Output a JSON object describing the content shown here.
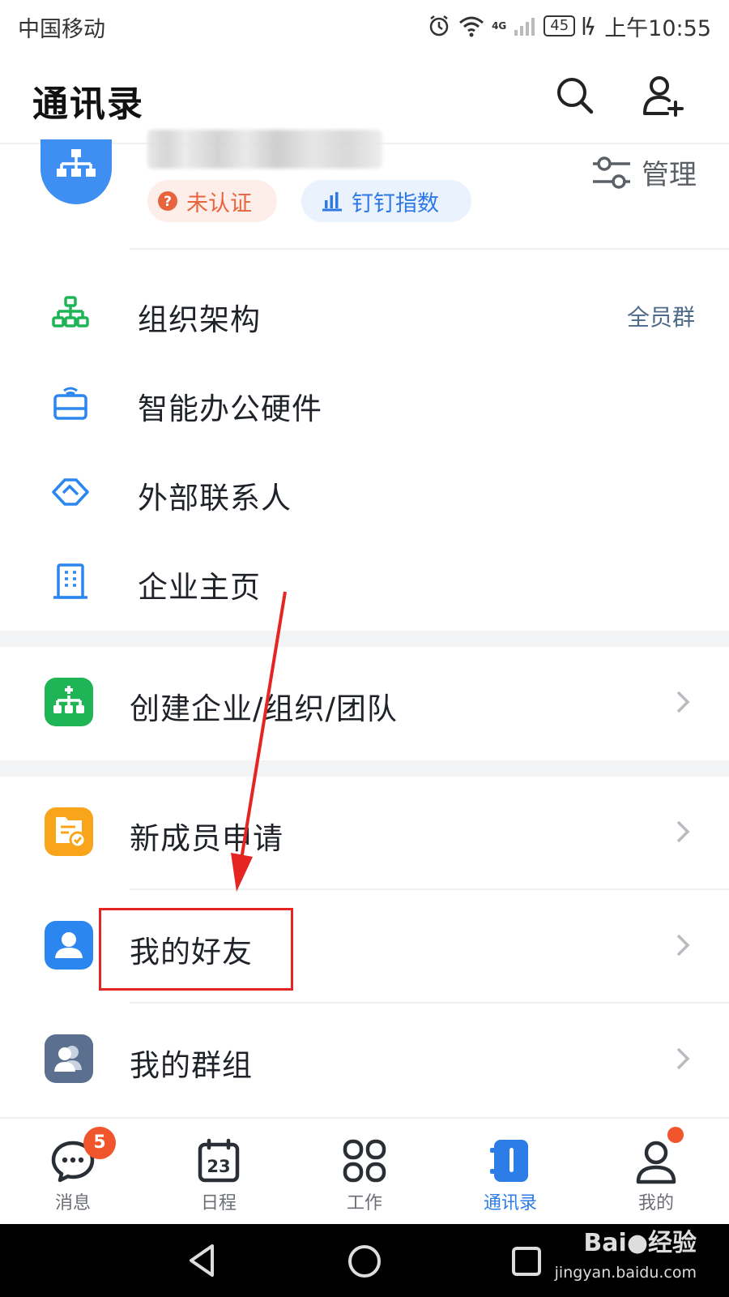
{
  "status_bar": {
    "carrier": "中国移动",
    "network": "4G",
    "battery": "45",
    "time": "上午10:55"
  },
  "header": {
    "title": "通讯录",
    "search_icon": "search-icon",
    "add_contact_icon": "add-contact-icon"
  },
  "org_card": {
    "avatar_icon": "org-hierarchy-icon",
    "badge_unverified": "未认证",
    "badge_index": "钉钉指数",
    "manage_label": "管理"
  },
  "menu": [
    {
      "label": "组织架构",
      "extra": "全员群",
      "icon": "org-tree-icon"
    },
    {
      "label": "智能办公硬件",
      "icon": "hardware-icon"
    },
    {
      "label": "外部联系人",
      "icon": "handshake-icon"
    },
    {
      "label": "企业主页",
      "icon": "building-icon"
    }
  ],
  "cards": [
    {
      "label": "创建企业/组织/团队",
      "icon": "create-org-icon",
      "color": "#1fb456"
    },
    {
      "label": "新成员申请",
      "icon": "member-apply-icon",
      "color": "#f8a51c"
    },
    {
      "label": "我的好友",
      "icon": "friend-icon",
      "color": "#2b86ef"
    },
    {
      "label": "我的群组",
      "icon": "group-icon",
      "color": "#5b6f8f"
    }
  ],
  "tabs": [
    {
      "label": "消息",
      "icon": "message-icon",
      "badge": "5"
    },
    {
      "label": "日程",
      "icon": "calendar-icon",
      "day": "23"
    },
    {
      "label": "工作",
      "icon": "apps-grid-icon"
    },
    {
      "label": "通讯录",
      "icon": "contacts-icon",
      "active": true
    },
    {
      "label": "我的",
      "icon": "profile-icon"
    }
  ],
  "watermark": {
    "brand": "Bai",
    "brand_suffix": "经验",
    "url": "jingyan.baidu.com"
  },
  "colors": {
    "accent": "#2d7de8",
    "annotation": "#e52521",
    "badge_red": "#f0552c"
  }
}
